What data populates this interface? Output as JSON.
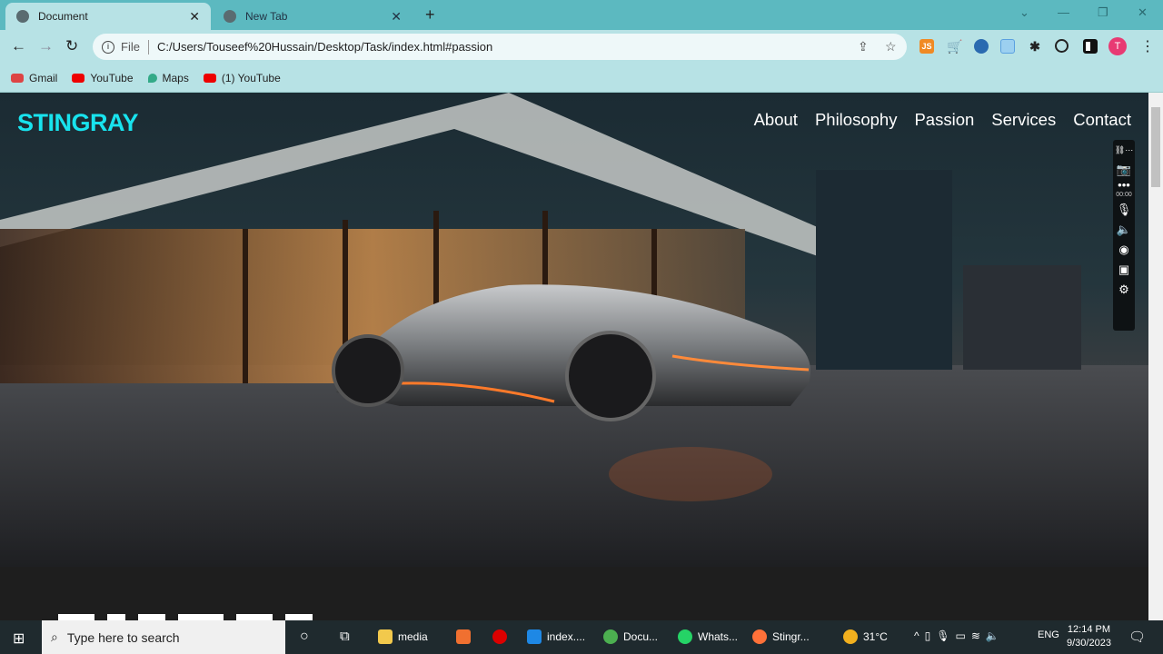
{
  "browser": {
    "tabs": [
      {
        "label": "Document",
        "active": true
      },
      {
        "label": "New Tab",
        "active": false
      }
    ],
    "address": {
      "scheme_label": "File",
      "url": "C:/Users/Touseef%20Hussain/Desktop/Task/index.html#passion"
    },
    "profile_initial": "T",
    "extensions": [
      {
        "icon": "js-icon",
        "label": "JS",
        "color": "#f08a24"
      },
      {
        "icon": "cart-icon",
        "color": "#d32"
      },
      {
        "icon": "gamepad-icon",
        "color": "#2a6ab0"
      },
      {
        "icon": "portrait-icon",
        "color": "#5aa0e0"
      },
      {
        "icon": "puzzle-icon",
        "color": "#222"
      }
    ],
    "bookmarks": [
      {
        "label": "Gmail",
        "color": "#d44"
      },
      {
        "label": "YouTube",
        "color": "#e00"
      },
      {
        "label": "Maps",
        "color": "#3a8"
      },
      {
        "label": "(1) YouTube",
        "color": "#e00"
      }
    ]
  },
  "site": {
    "logo": "STINGRAY",
    "nav": [
      "About",
      "Philosophy",
      "Passion",
      "Services",
      "Contact"
    ],
    "recorder_time": "00:00"
  },
  "taskbar": {
    "search_placeholder": "Type here to search",
    "apps": [
      {
        "label": "media",
        "color": "#f2c94c"
      },
      {
        "label": "index....",
        "color": "#1e88e5"
      },
      {
        "label": "Docu...",
        "color": "#4caf50"
      },
      {
        "label": "Whats...",
        "color": "#25d366"
      },
      {
        "label": "Stingr...",
        "color": "#ff7139"
      }
    ],
    "weather": "31°C",
    "lang": "ENG",
    "time": "12:14 PM",
    "date": "9/30/2023"
  }
}
